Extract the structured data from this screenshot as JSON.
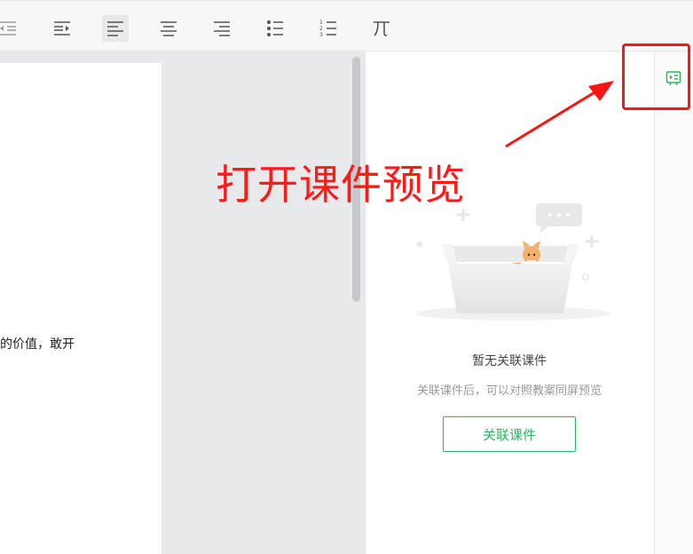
{
  "toolbar": {
    "buttons": [
      {
        "name": "outdent",
        "active": false
      },
      {
        "name": "indent",
        "active": false
      },
      {
        "name": "align-left",
        "active": true
      },
      {
        "name": "align-center",
        "active": false
      },
      {
        "name": "align-right",
        "active": false
      },
      {
        "name": "bullet-list",
        "active": false
      },
      {
        "name": "numbered-list",
        "active": false
      },
      {
        "name": "formula",
        "active": false
      }
    ],
    "numbered_list_digits": [
      "1",
      "2",
      "3"
    ]
  },
  "document": {
    "visible_text": "的价值，敢开"
  },
  "preview_panel": {
    "empty_title": "暂无关联课件",
    "empty_desc": "关联课件后，可以对照教案同屏预览",
    "link_button_label": "关联课件"
  },
  "annotation": {
    "text": "打开课件预览"
  },
  "colors": {
    "accent_green": "#2db65f",
    "annotation_red": "#ff1414"
  },
  "icons": {
    "preview_toggle": "courseware-preview-icon"
  }
}
